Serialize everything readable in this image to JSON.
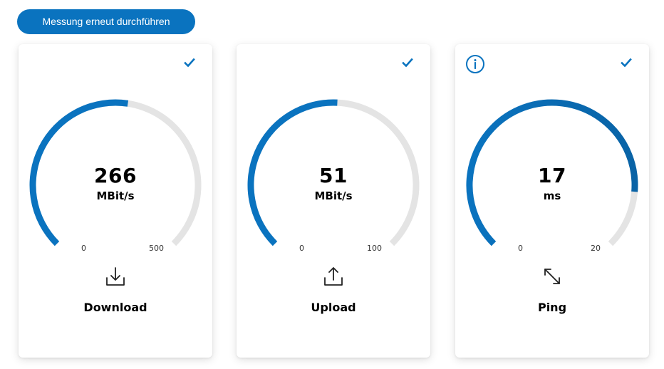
{
  "rerun_label": "Messung erneut durchführen",
  "colors": {
    "accent": "#0a73bf",
    "accent_dark": "#0963a6",
    "track": "#e4e4e4"
  },
  "cards": [
    {
      "id": "download",
      "value": "266",
      "value_num": 266,
      "unit": "MBit/s",
      "min": "0",
      "max": "500",
      "max_num": 500,
      "label": "Download",
      "icon": "download-icon",
      "status_icon": "check-icon"
    },
    {
      "id": "upload",
      "value": "51",
      "value_num": 51,
      "unit": "MBit/s",
      "min": "0",
      "max": "100",
      "max_num": 100,
      "label": "Upload",
      "icon": "upload-icon",
      "status_icon": "check-icon"
    },
    {
      "id": "ping",
      "value": "17",
      "value_num": 17,
      "unit": "ms",
      "min": "0",
      "max": "20",
      "max_num": 20,
      "label": "Ping",
      "icon": "ping-arrows-icon",
      "status_icon": "check-icon",
      "info_icon": "info-icon"
    }
  ]
}
